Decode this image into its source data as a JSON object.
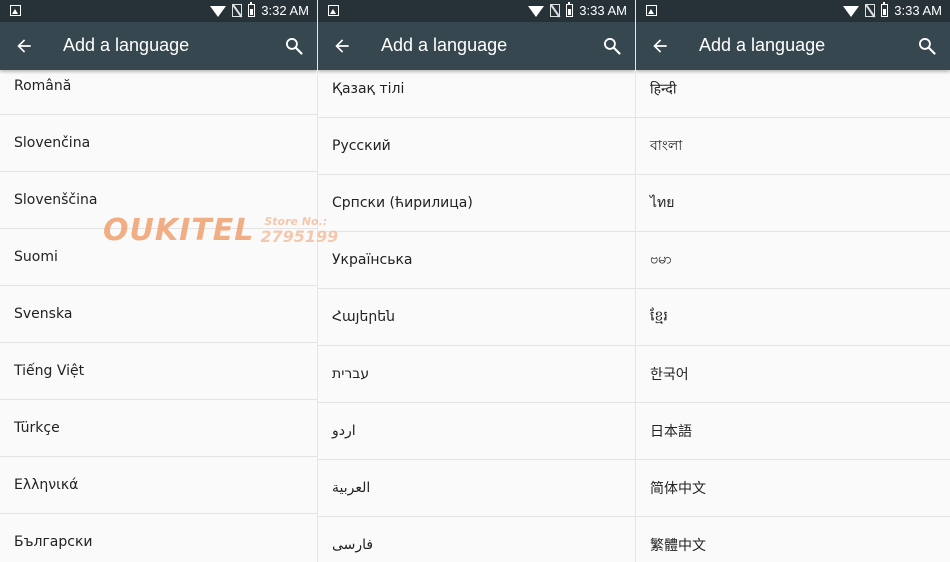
{
  "watermark": {
    "brand": "OUKITEL",
    "store_label": "Store No.:",
    "store_number": "2795199"
  },
  "screens": [
    {
      "status_time": "3:32 AM",
      "title": "Add a language",
      "languages": [
        "Română",
        "Slovenčina",
        "Slovenščina",
        "Suomi",
        "Svenska",
        "Tiếng Việt",
        "Türkçe",
        "Ελληνικά",
        "Български"
      ]
    },
    {
      "status_time": "3:33 AM",
      "title": "Add a language",
      "languages": [
        "Қазақ тілі",
        "Русский",
        "Српски (ћирилица)",
        "Українська",
        "Հայերեն",
        "עברית",
        "اردو",
        "العربية",
        "فارسی"
      ]
    },
    {
      "status_time": "3:33 AM",
      "title": "Add a language",
      "languages": [
        "हिन्दी",
        "বাংলা",
        "ไทย",
        "ဗမာ",
        "ខ្មែរ",
        "한국어",
        "日本語",
        "简体中文",
        "繁體中文"
      ]
    }
  ],
  "colors": {
    "status_bar": "#263238",
    "toolbar": "#37474f",
    "list_bg": "#fafafa",
    "divider": "#e3e3e3"
  },
  "icons": [
    "image-icon",
    "wifi-icon",
    "no-sim-icon",
    "battery-icon",
    "back-arrow-icon",
    "search-icon"
  ]
}
